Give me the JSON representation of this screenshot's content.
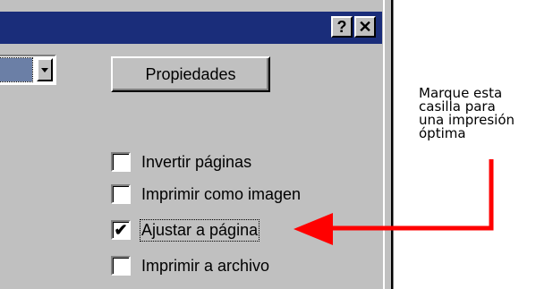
{
  "titlebar": {
    "help_label": "?",
    "close_label": "✕"
  },
  "dialog": {
    "properties_button": "Propiedades",
    "options": [
      {
        "label": "Invertir páginas",
        "checked": false
      },
      {
        "label": "Imprimir como imagen",
        "checked": false
      },
      {
        "label": "Ajustar a página",
        "checked": true
      },
      {
        "label": "Imprimir a archivo",
        "checked": false
      }
    ],
    "checkmark": "✔"
  },
  "callout": {
    "lines": [
      "Marque esta",
      "casilla para",
      "una impresión",
      "óptima"
    ],
    "arrow_color": "#ff0000"
  },
  "colors": {
    "dialog_bg": "#c0c0c0",
    "titlebar_bg": "#1a2d7a",
    "selected_field": "#6b7fa6"
  }
}
